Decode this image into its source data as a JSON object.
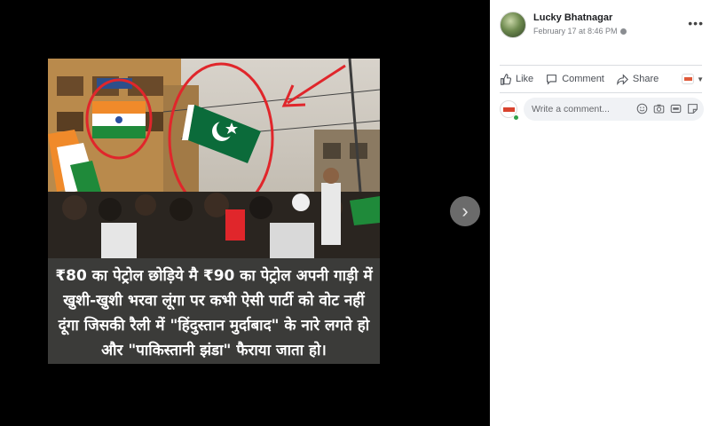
{
  "post": {
    "author": "Lucky Bhatnagar",
    "timestamp": "February 17 at 8:46 PM",
    "more_label": "•••"
  },
  "photo": {
    "caption_lines": [
      "₹80 का पेट्रोल छोड़िये मै ₹90 का पेट्रोल अपनी गाड़ी में",
      "खुशी-खुशी भरवा लूंगा पर कभी ऐसी पार्टी को वोट नहीं",
      "दूंगा जिसकी रैली में \"हिंदुस्तान मुर्दाबाद\" के नारे लगते हो",
      "और \"पाकिस्तानी झंडा\" फैराया जाता हो।"
    ]
  },
  "viewer": {
    "next_label": "›"
  },
  "actions": {
    "like": "Like",
    "comment": "Comment",
    "share": "Share",
    "caret": "▼"
  },
  "comment_input": {
    "placeholder": "Write a comment..."
  },
  "icons": [
    "chevron-right-icon",
    "globe-icon",
    "more-icon",
    "like-icon",
    "comment-icon",
    "share-icon",
    "emoji-icon",
    "camera-icon",
    "gif-icon",
    "sticker-icon"
  ],
  "colors": {
    "viewer_bg": "#000000",
    "panel_bg": "#ffffff",
    "input_bg": "#f0f2f5",
    "annotation_red": "#e0262b",
    "pak_flag_green": "#0b6b3a",
    "saffron": "#f08a2a"
  }
}
